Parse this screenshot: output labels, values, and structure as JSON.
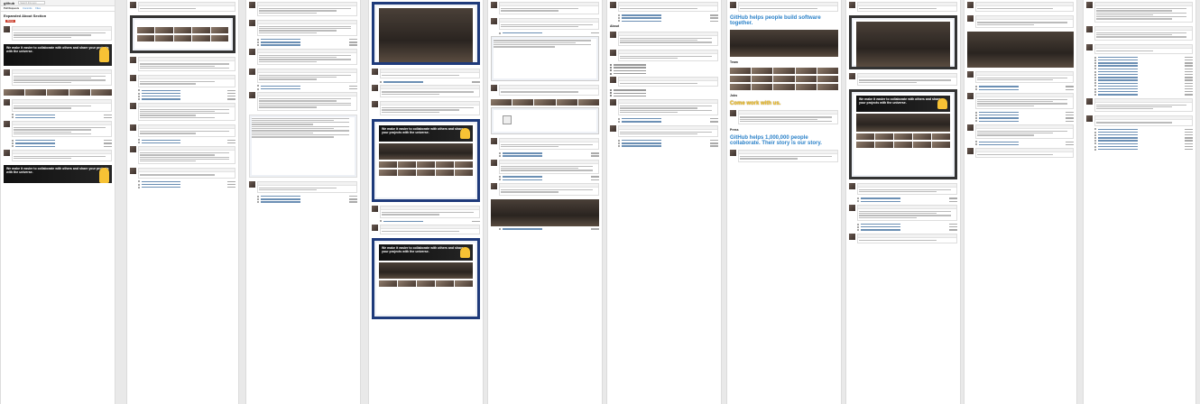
{
  "header": {
    "logo": "github",
    "search_placeholder": "Search this repo",
    "tabs": [
      "Pull Requests",
      "Commits",
      "Files"
    ]
  },
  "pull_request": {
    "title": "Expanded About Section",
    "merge_label": "Merge"
  },
  "banners": {
    "collaborate": "We make it easier to collaborate with others and share your projects with the universe.",
    "helps": "GitHub helps people build software together.",
    "come_work": "Come work with us.",
    "million": "GitHub helps 1,000,000 people collaborate. Their story is our story."
  },
  "sections": {
    "about": "About",
    "team": "Team",
    "jobs": "Jobs",
    "press": "Press"
  },
  "colors": {
    "merge": "#cc4433",
    "link": "#4183c4",
    "banner_dark": "#111111",
    "octocat_yellow": "#f7c235",
    "frame_blue": "#1e3a7a"
  }
}
